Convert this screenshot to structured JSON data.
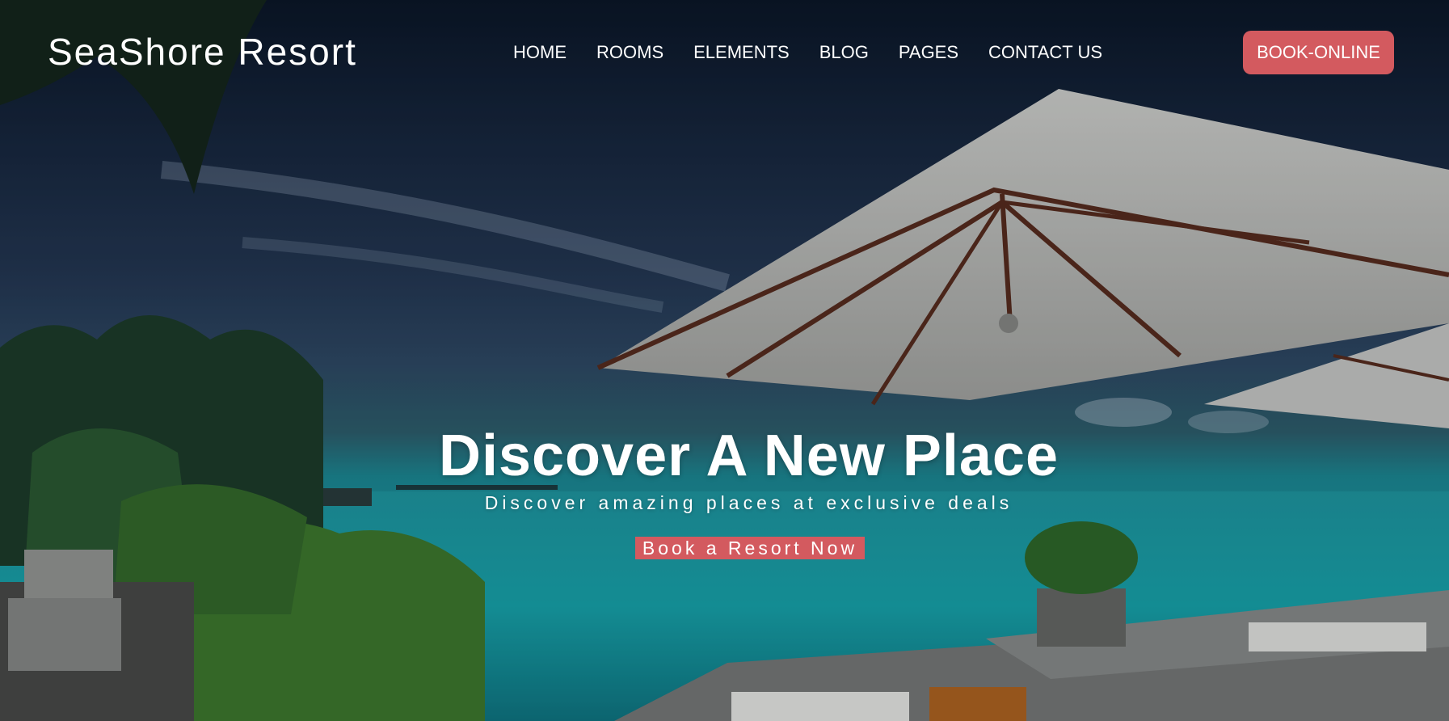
{
  "brand": {
    "name": "SeaShore Resort"
  },
  "nav": {
    "items": [
      {
        "label": "HOME"
      },
      {
        "label": "ROOMS"
      },
      {
        "label": "ELEMENTS"
      },
      {
        "label": "BLOG"
      },
      {
        "label": "PAGES"
      },
      {
        "label": "CONTACT US"
      }
    ],
    "book_label": "BOOK-ONLINE"
  },
  "hero": {
    "title": "Discover A New Place",
    "subtitle": "Discover amazing places at exclusive deals",
    "cta_label": "Book a Resort Now"
  },
  "colors": {
    "accent": "#d35a5f",
    "text": "#ffffff"
  }
}
